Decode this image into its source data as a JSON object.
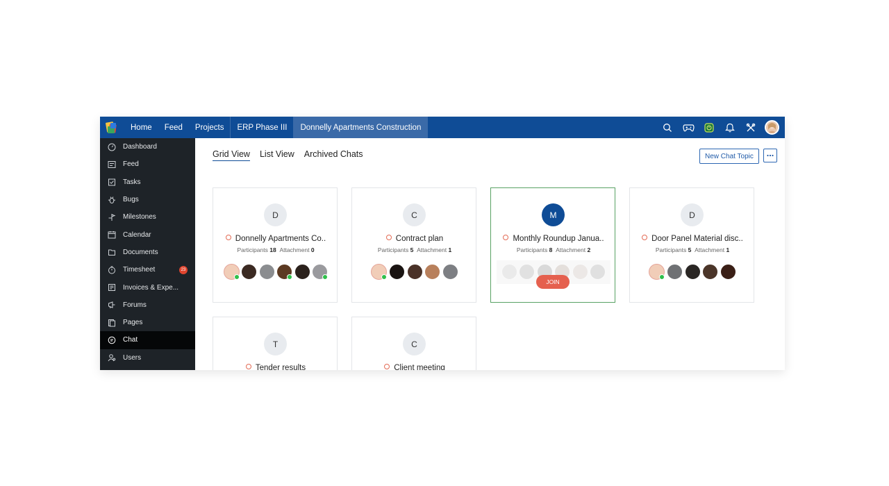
{
  "topnav": {
    "items": [
      {
        "label": "Home"
      },
      {
        "label": "Feed"
      },
      {
        "label": "Projects"
      },
      {
        "label": "ERP Phase III"
      },
      {
        "label": "Donnelly Apartments Construction"
      }
    ],
    "icons": [
      "search-icon",
      "gamepad-icon",
      "timer-icon",
      "bell-icon",
      "tools-icon"
    ]
  },
  "sidebar": {
    "items": [
      {
        "label": "Dashboard",
        "icon": "dashboard-icon"
      },
      {
        "label": "Feed",
        "icon": "feed-icon"
      },
      {
        "label": "Tasks",
        "icon": "tasks-icon"
      },
      {
        "label": "Bugs",
        "icon": "bug-icon"
      },
      {
        "label": "Milestones",
        "icon": "milestone-icon"
      },
      {
        "label": "Calendar",
        "icon": "calendar-icon"
      },
      {
        "label": "Documents",
        "icon": "documents-icon"
      },
      {
        "label": "Timesheet",
        "icon": "timesheet-icon",
        "badge": "23"
      },
      {
        "label": "Invoices & Expe...",
        "icon": "invoice-icon"
      },
      {
        "label": "Forums",
        "icon": "forum-icon"
      },
      {
        "label": "Pages",
        "icon": "pages-icon"
      },
      {
        "label": "Chat",
        "icon": "chat-icon",
        "active": true
      },
      {
        "label": "Users",
        "icon": "users-icon"
      }
    ]
  },
  "tabs": [
    {
      "label": "Grid View",
      "active": true
    },
    {
      "label": "List View"
    },
    {
      "label": "Archived Chats"
    }
  ],
  "actions": {
    "new_chat": "New Chat Topic",
    "more": "•••"
  },
  "labels": {
    "participants": "Participants",
    "attachment": "Attachment"
  },
  "cards": [
    {
      "letter": "D",
      "title": "Donnelly Apartments Co..",
      "participants": "18",
      "attachments": "0"
    },
    {
      "letter": "C",
      "title": "Contract plan",
      "participants": "5",
      "attachments": "1"
    },
    {
      "letter": "M",
      "title": "Monthly Roundup Janua..",
      "participants": "8",
      "attachments": "2",
      "join": "JOIN"
    },
    {
      "letter": "D",
      "title": "Door Panel Material disc..",
      "participants": "5",
      "attachments": "1"
    },
    {
      "letter": "T",
      "title": "Tender results"
    },
    {
      "letter": "C",
      "title": "Client meeting"
    }
  ],
  "colors": {
    "nav": "#0f4c96",
    "sidebar": "#1e2328",
    "accent": "#e5604e",
    "highlight": "#58a163"
  }
}
